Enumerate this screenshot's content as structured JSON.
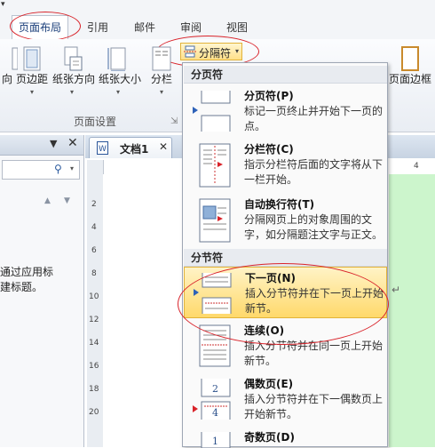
{
  "ribbon": {
    "tabs": {
      "layout": "页面布局",
      "references": "引用",
      "mailings": "邮件",
      "review": "审阅",
      "view": "视图"
    },
    "breaks_button": "分隔符",
    "buttons": {
      "direction": "向",
      "margins": "页边距",
      "orientation": "纸张方向",
      "size": "纸张大小",
      "columns": "分栏",
      "page_borders": "页面边框"
    },
    "group_label": "页面设置"
  },
  "document": {
    "tab_title": "文档1",
    "nav_text_line1": "通过应用标",
    "nav_text_line2": "建标题。"
  },
  "menu": {
    "page_breaks_header": "分页符",
    "section_breaks_header": "分节符",
    "items": [
      {
        "title": "分页符(P)",
        "desc": "标记一页终止并开始下一页的点。"
      },
      {
        "title": "分栏符(C)",
        "desc": "指示分栏符后面的文字将从下一栏开始。"
      },
      {
        "title": "自动换行符(T)",
        "desc": "分隔网页上的对象周围的文字，如分隔题注文字与正文。"
      },
      {
        "title": "下一页(N)",
        "desc": "插入分节符并在下一页上开始新节。"
      },
      {
        "title": "连续(O)",
        "desc": "插入分节符并在同一页上开始新节。"
      },
      {
        "title": "偶数页(E)",
        "desc": "插入分节符并在下一偶数页上开始新节。"
      },
      {
        "title": "奇数页(D)",
        "desc": ""
      }
    ]
  },
  "ruler": {
    "h_marks": [
      "4"
    ],
    "v_marks": [
      "2",
      "4",
      "6",
      "8",
      "10",
      "12",
      "14",
      "16",
      "18",
      "20"
    ]
  },
  "colors": {
    "annotation": "#d9232a",
    "highlight": "#ffd96b",
    "green_pane": "#ccf5cc"
  }
}
